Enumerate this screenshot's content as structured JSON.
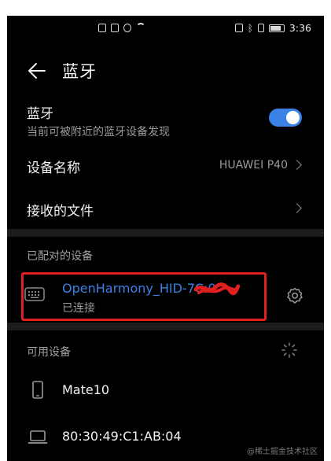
{
  "status_bar": {
    "time": "3:36",
    "left_icons": [
      "notification-icon",
      "photo-icon",
      "chat-icon",
      "wifi-icon"
    ],
    "right_icons": [
      "nfc-icon",
      "bluetooth-icon",
      "vibrate-icon",
      "battery-icon"
    ]
  },
  "header": {
    "title": "蓝牙",
    "back_icon": "back-arrow-icon"
  },
  "bluetooth": {
    "label": "蓝牙",
    "subtitle": "当前可被附近的蓝牙设备发现",
    "enabled": true,
    "toggle_color": "#3b82e6"
  },
  "device_name": {
    "label": "设备名称",
    "value": "HUAWEI P40"
  },
  "received_files": {
    "label": "接收的文件"
  },
  "paired": {
    "section_title": "已配对的设备",
    "devices": [
      {
        "name": "OpenHarmony_HID-7C:0",
        "status": "已连接",
        "icon": "keyboard-icon",
        "settings_icon": "gear-icon"
      }
    ]
  },
  "available": {
    "section_title": "可用设备",
    "devices": [
      {
        "name": "Mate10",
        "icon": "phone-icon"
      },
      {
        "name": "80:30:49:C1:AB:04",
        "icon": "laptop-icon"
      }
    ]
  },
  "watermark": "@稀土掘金技术社区",
  "colors": {
    "accent": "#3b82e6",
    "highlight_border": "#e21f1f",
    "background": "#000000"
  }
}
